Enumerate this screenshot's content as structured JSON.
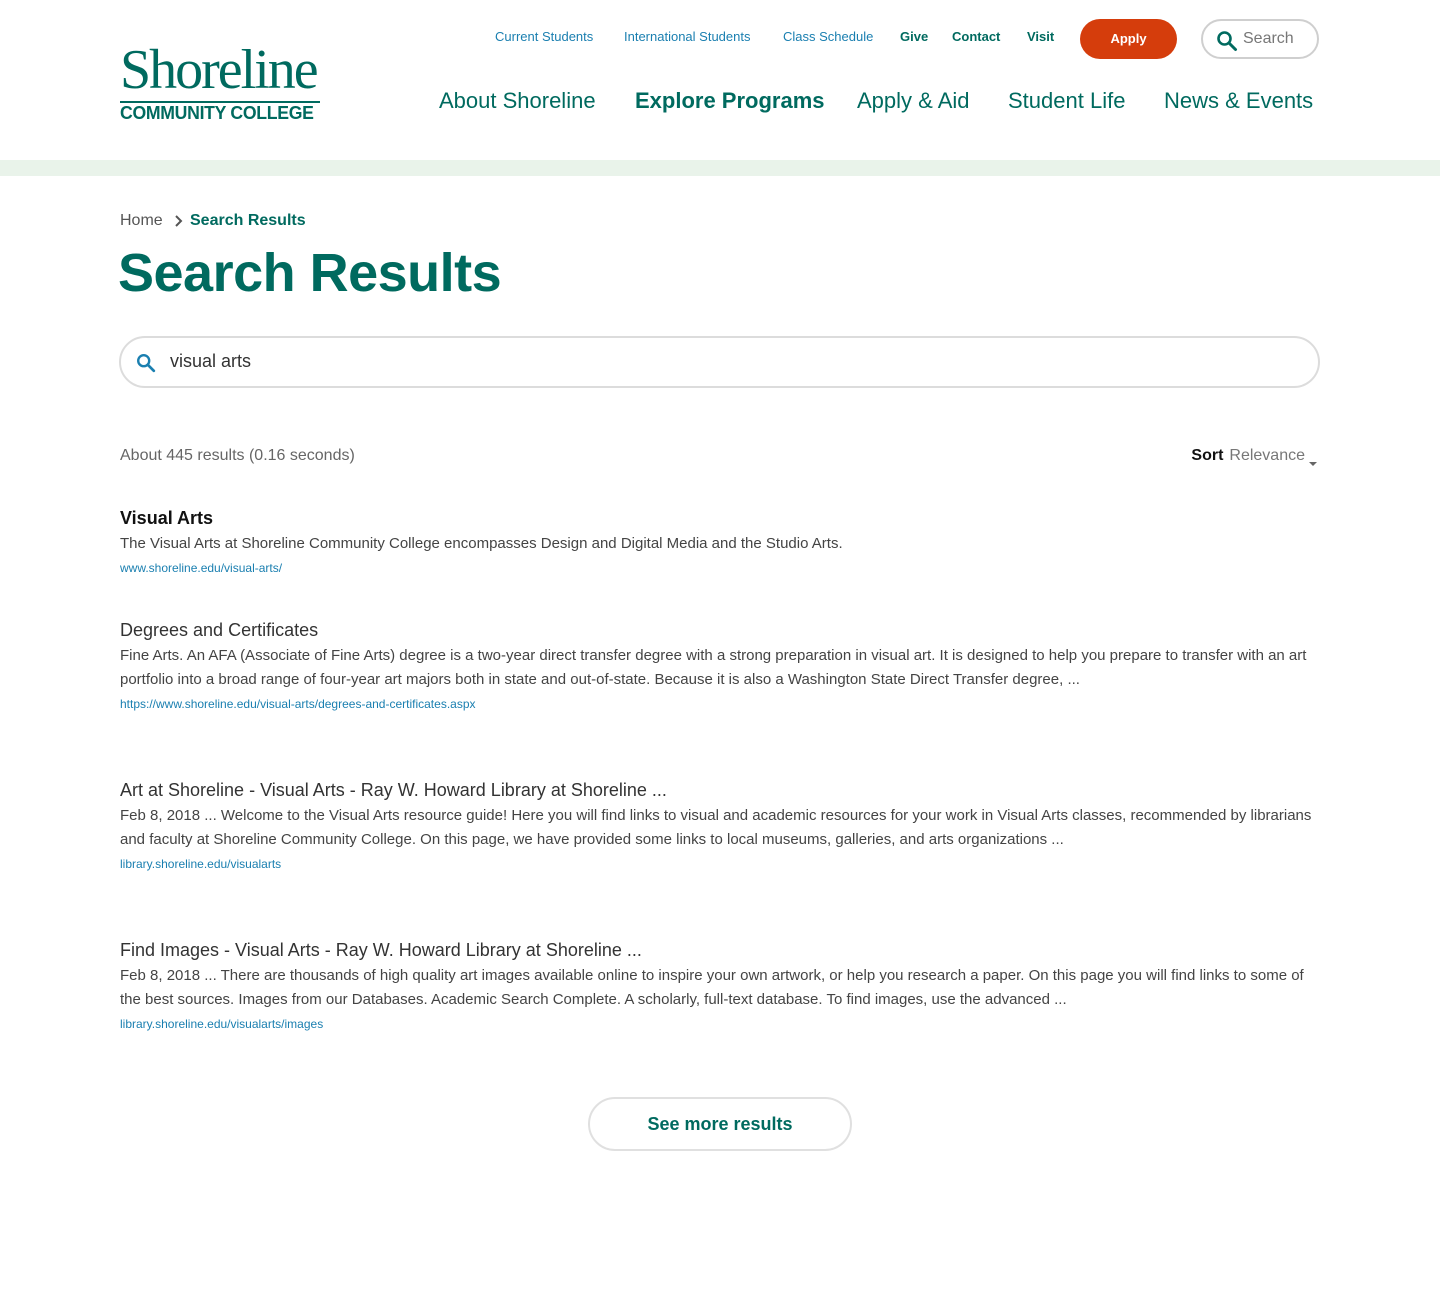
{
  "brand": {
    "name": "Shoreline",
    "subtitle": "COMMUNITY COLLEGE",
    "primary_color": "#006a5f",
    "accent_color": "#d53d0c",
    "link_color": "#1a7fb0"
  },
  "utility_nav": {
    "current_students": "Current Students",
    "international_students": "International Students",
    "class_schedule": "Class Schedule",
    "give": "Give",
    "contact": "Contact",
    "visit": "Visit",
    "apply": "Apply"
  },
  "header_search": {
    "placeholder": "Search",
    "icon": "search-icon"
  },
  "main_nav": {
    "about": "About Shoreline",
    "explore": "Explore Programs",
    "apply_aid": "Apply & Aid",
    "student_life": "Student Life",
    "news_events": "News & Events",
    "active": "Explore Programs"
  },
  "breadcrumb": {
    "home": "Home",
    "separator_icon": "chevron-right-icon",
    "current": "Search Results"
  },
  "page_title": "Search Results",
  "search": {
    "value": "visual arts",
    "icon": "search-icon"
  },
  "results_meta": {
    "count_text": "About 445 results (0.16 seconds)",
    "sort_label": "Sort",
    "sort_value": "Relevance",
    "sort_icon": "caret-down-icon"
  },
  "results": [
    {
      "title": "Visual Arts",
      "snippet": "The Visual Arts at Shoreline Community College encompasses Design and Digital Media and the Studio Arts.",
      "url": "www.shoreline.edu/visual-arts/"
    },
    {
      "title": "Degrees and Certificates",
      "snippet": "Fine Arts. An AFA (Associate of Fine Arts) degree is a two-year direct transfer degree with a strong preparation in visual art. It is designed to help you prepare to transfer with an art portfolio into a broad range of four-year art majors both in state and out-of-state. Because it is also a Washington State Direct Transfer degree, ...",
      "url": "https://www.shoreline.edu/visual-arts/degrees-and-certificates.aspx"
    },
    {
      "title": "Art at Shoreline - Visual Arts - Ray W. Howard Library at Shoreline ...",
      "snippet": "Feb 8, 2018 ... Welcome to the Visual Arts resource guide! Here you will find links to visual and academic resources for your work in Visual Arts classes, recommended by librarians and faculty at Shoreline Community College. On this page, we have provided some links to local museums, galleries, and arts organizations ...",
      "url": "library.shoreline.edu/visualarts"
    },
    {
      "title": "Find Images - Visual Arts - Ray W. Howard Library at Shoreline ...",
      "snippet": "Feb 8, 2018 ... There are thousands of high quality art images available online to inspire your own artwork, or help you research a paper. On this page you will find links to some of the best sources. Images from our Databases. Academic Search Complete. A scholarly, full-text database. To find images, use the advanced ...",
      "url": "library.shoreline.edu/visualarts/images"
    }
  ],
  "see_more": "See more results"
}
